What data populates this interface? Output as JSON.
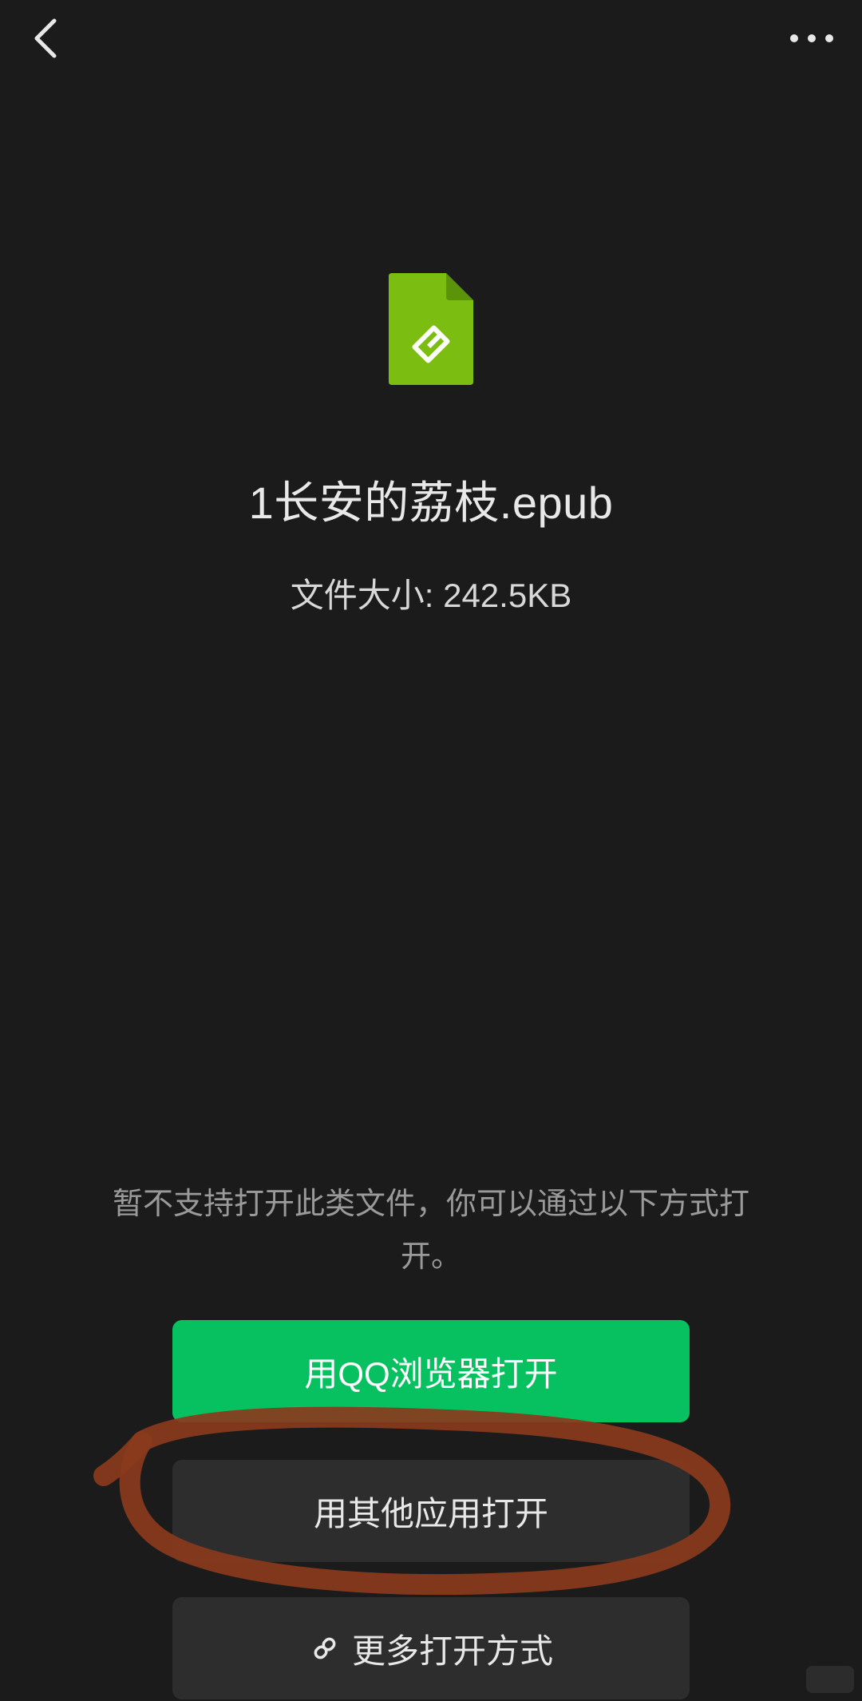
{
  "header": {
    "back_icon": "chevron-left-icon",
    "more_icon": "more-horizontal-icon"
  },
  "file": {
    "icon": "epub-file-icon",
    "icon_color": "#7cbd12",
    "name": "1长安的荔枝.epub",
    "size_label": "文件大小:",
    "size_value": "242.5KB"
  },
  "notice": {
    "line1": "暂不支持打开此类文件，你可以通过以下方式打",
    "line2": "开。"
  },
  "actions": {
    "qq_browser_label": "用QQ浏览器打开",
    "other_app_label": "用其他应用打开",
    "more_ways_label": "更多打开方式",
    "more_ways_icon": "link-icon"
  },
  "colors": {
    "background": "#1b1b1b",
    "primary": "#07c160",
    "secondary": "#2d2d2d",
    "annotation": "#8a3a1c"
  }
}
